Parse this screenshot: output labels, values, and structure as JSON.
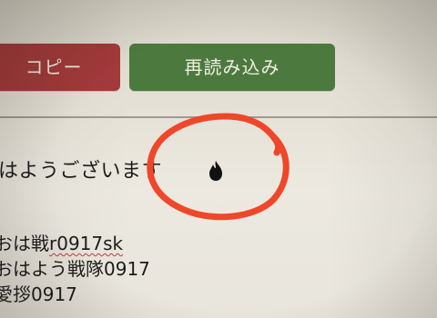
{
  "toolbar": {
    "copy_label": "コピー",
    "reload_label": "再読み込み",
    "copy_color": "#a33a3a",
    "reload_color": "#4c7a3e"
  },
  "message": {
    "text": "はようございます",
    "icon": "fire-icon"
  },
  "entries": [
    {
      "prefix": "おは戦",
      "suffix": "r0917sk"
    },
    {
      "text": "おはよう戦隊0917"
    },
    {
      "text": "愛拶0917"
    }
  ],
  "annotation": {
    "shape": "hand-drawn-circle",
    "color": "#f0462a"
  }
}
